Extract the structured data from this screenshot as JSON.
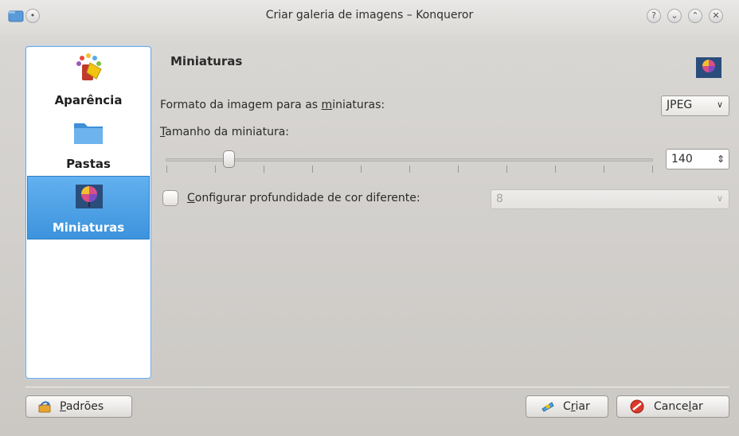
{
  "window": {
    "title": "Criar galeria de imagens – Konqueror",
    "controls": [
      "help",
      "minimize",
      "maximize",
      "close"
    ]
  },
  "sidebar": {
    "items": [
      {
        "label": "Aparência",
        "icon": "paint-brush-icon",
        "selected": false
      },
      {
        "label": "Pastas",
        "icon": "folder-icon",
        "selected": false
      },
      {
        "label": "Miniaturas",
        "icon": "thumbnail-balloon-icon",
        "selected": true
      }
    ]
  },
  "page": {
    "title": "Miniaturas",
    "format_label_pre": "Formato da imagem para as ",
    "format_label_u": "m",
    "format_label_post": "iniaturas:",
    "format_value": "JPEG",
    "size_label_u": "T",
    "size_label_post": "amanho da miniatura:",
    "size_value": "140",
    "depth_checkbox_u": "C",
    "depth_checkbox_post": "onfigurar profundidade de cor diferente:",
    "depth_checked": false,
    "depth_value": "8"
  },
  "buttons": {
    "defaults_pre": "",
    "defaults_u": "P",
    "defaults_post": "adrões",
    "create_pre": "C",
    "create_u": "r",
    "create_post": "iar",
    "cancel_pre": "Cance",
    "cancel_u": "l",
    "cancel_post": "ar"
  },
  "colors": {
    "selection": "#4a9ee3",
    "sidebar_border": "#6fa8dc"
  }
}
